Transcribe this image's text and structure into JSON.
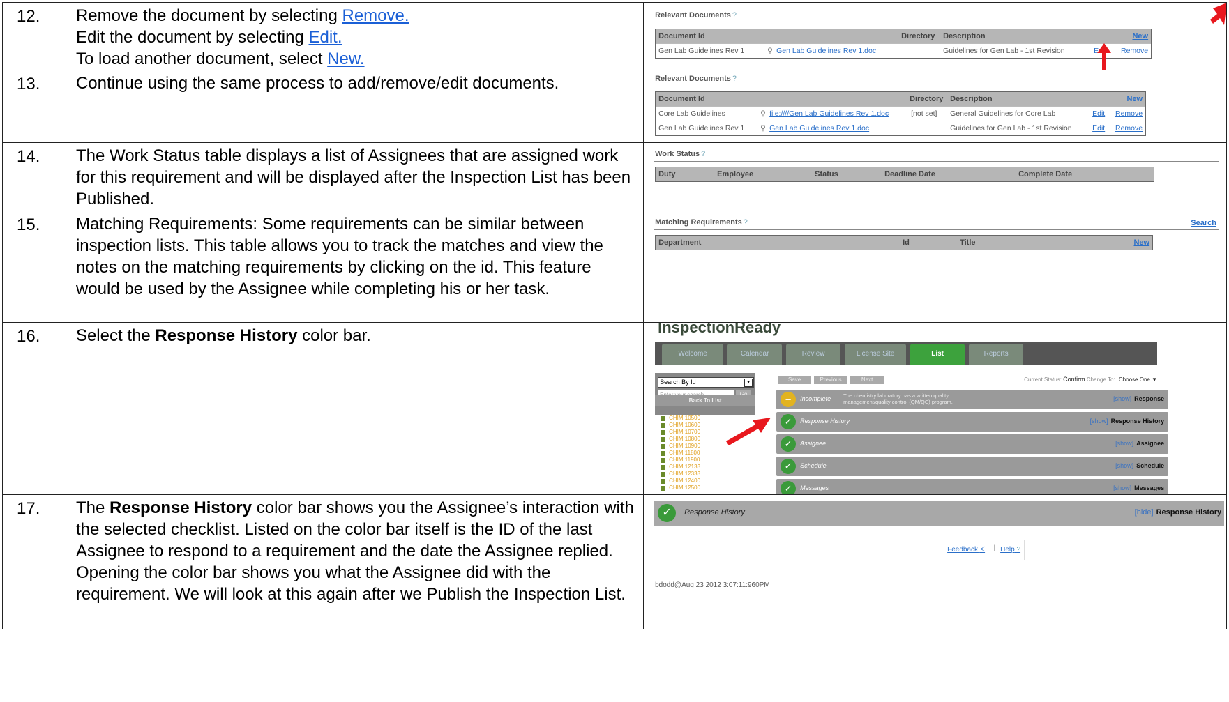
{
  "rows": [
    {
      "num": "12.",
      "lines": [
        {
          "pre": "Remove the document by selecting ",
          "link": "Remove."
        },
        {
          "pre": "Edit the document by selecting ",
          "link": "Edit."
        },
        {
          "pre": "To load another document, select ",
          "link": "New."
        }
      ]
    },
    {
      "num": "13.",
      "text": "Continue using the same process to add/remove/edit documents."
    },
    {
      "num": "14.",
      "text": "The Work Status table displays a list of Assignees that are assigned work for this requirement and will be displayed after the Inspection List has been Published."
    },
    {
      "num": "15.",
      "text": "Matching Requirements:  Some requirements can be similar between inspection lists.  This table allows you to track the matches and view the notes on the matching requirements by clicking on the id.  This feature would be used by the Assignee while completing his or her task."
    },
    {
      "num": "16.",
      "pre": "Select the ",
      "bold": "Response History",
      "post": " color bar."
    },
    {
      "num": "17.",
      "pre": "The ",
      "bold": "Response History",
      "post": " color bar shows you the Assignee’s interaction with the selected checklist.  Listed on the color bar itself is the ID of the last Assignee to respond to a requirement and the date the Assignee replied.  Opening the color bar shows you what the Assignee did with the requirement.  We will look at this again after we Publish the Inspection List."
    }
  ],
  "docs1": {
    "title": "Relevant Documents",
    "q": "?",
    "headers": {
      "id": "Document Id",
      "dir": "Directory",
      "desc": "Description",
      "new": "New"
    },
    "rows": [
      {
        "id": "Gen Lab Guidelines Rev 1",
        "file": "Gen Lab Guidelines Rev 1.doc",
        "dir": "",
        "desc": "Guidelines for Gen Lab - 1st Revision",
        "edit": "Edit",
        "remove": "Remove"
      }
    ]
  },
  "docs2": {
    "title": "Relevant Documents",
    "q": "?",
    "headers": {
      "id": "Document Id",
      "dir": "Directory",
      "desc": "Description",
      "new": "New"
    },
    "rows": [
      {
        "id": "Core Lab Guidelines",
        "file": "file:////Gen Lab Guidelines Rev 1.doc",
        "dir": "[not set]",
        "desc": "General Guidelines for Core Lab",
        "edit": "Edit",
        "remove": "Remove"
      },
      {
        "id": "Gen Lab Guidelines Rev 1",
        "file": "Gen Lab Guidelines Rev 1.doc",
        "dir": "",
        "desc": "Guidelines for Gen Lab - 1st Revision",
        "edit": "Edit",
        "remove": "Remove"
      }
    ]
  },
  "work": {
    "title": "Work Status",
    "q": "?",
    "headers": [
      "Duty",
      "Employee",
      "Status",
      "Deadline Date",
      "Complete Date"
    ]
  },
  "match": {
    "title": "Matching Requirements",
    "q": "?",
    "search": "Search",
    "headers": {
      "dept": "Department",
      "id": "Id",
      "title": "Title",
      "new": "New"
    }
  },
  "app": {
    "logo": "InspectionReady",
    "tabs": [
      "Welcome",
      "Calendar",
      "Review",
      "License Site",
      "List",
      "Reports"
    ],
    "active_tab": "List",
    "search_select": "Search By Id",
    "search_placeholder": "Enter your search...",
    "go": "Go",
    "back": "Back To List",
    "buttons": [
      "Save",
      "Previous",
      "Next"
    ],
    "status_label": "Current Status:",
    "status_value": "Confirm",
    "change_label": "Change To:",
    "change_value": "Choose One",
    "tree": [
      "CHIM 10500",
      "CHIM 10600",
      "CHIM 10700",
      "CHIM 10800",
      "CHIM 10900",
      "CHIM 11800",
      "CHIM 11900",
      "CHIM 12133",
      "CHIM 12333",
      "CHIM 12400",
      "CHIM 12500"
    ],
    "bars": [
      {
        "label": "Incomplete",
        "text": "The chemistry laboratory has a written quality management/quality control (QM/QC) program.",
        "show": "[show]",
        "right": "Response",
        "state": "y"
      },
      {
        "label": "Response History",
        "show": "[show]",
        "right": "Response History",
        "state": "g"
      },
      {
        "label": "Assignee",
        "show": "[show]",
        "right": "Assignee",
        "state": "g"
      },
      {
        "label": "Schedule",
        "show": "[show]",
        "right": "Schedule",
        "state": "g"
      },
      {
        "label": "Messages",
        "show": "[show]",
        "right": "Messages",
        "state": "g"
      }
    ]
  },
  "rh": {
    "label": "Response History",
    "hide": "[hide]",
    "right": "Response History",
    "feedback": "Feedback",
    "help": "Help",
    "entry": "bdodd@Aug 23 2012  3:07:11:960PM"
  },
  "accent": {
    "arrow": "#e8181e",
    "bar": "#9a9a9a",
    "green": "#3a9a3a",
    "link": "#1a5fd6"
  }
}
